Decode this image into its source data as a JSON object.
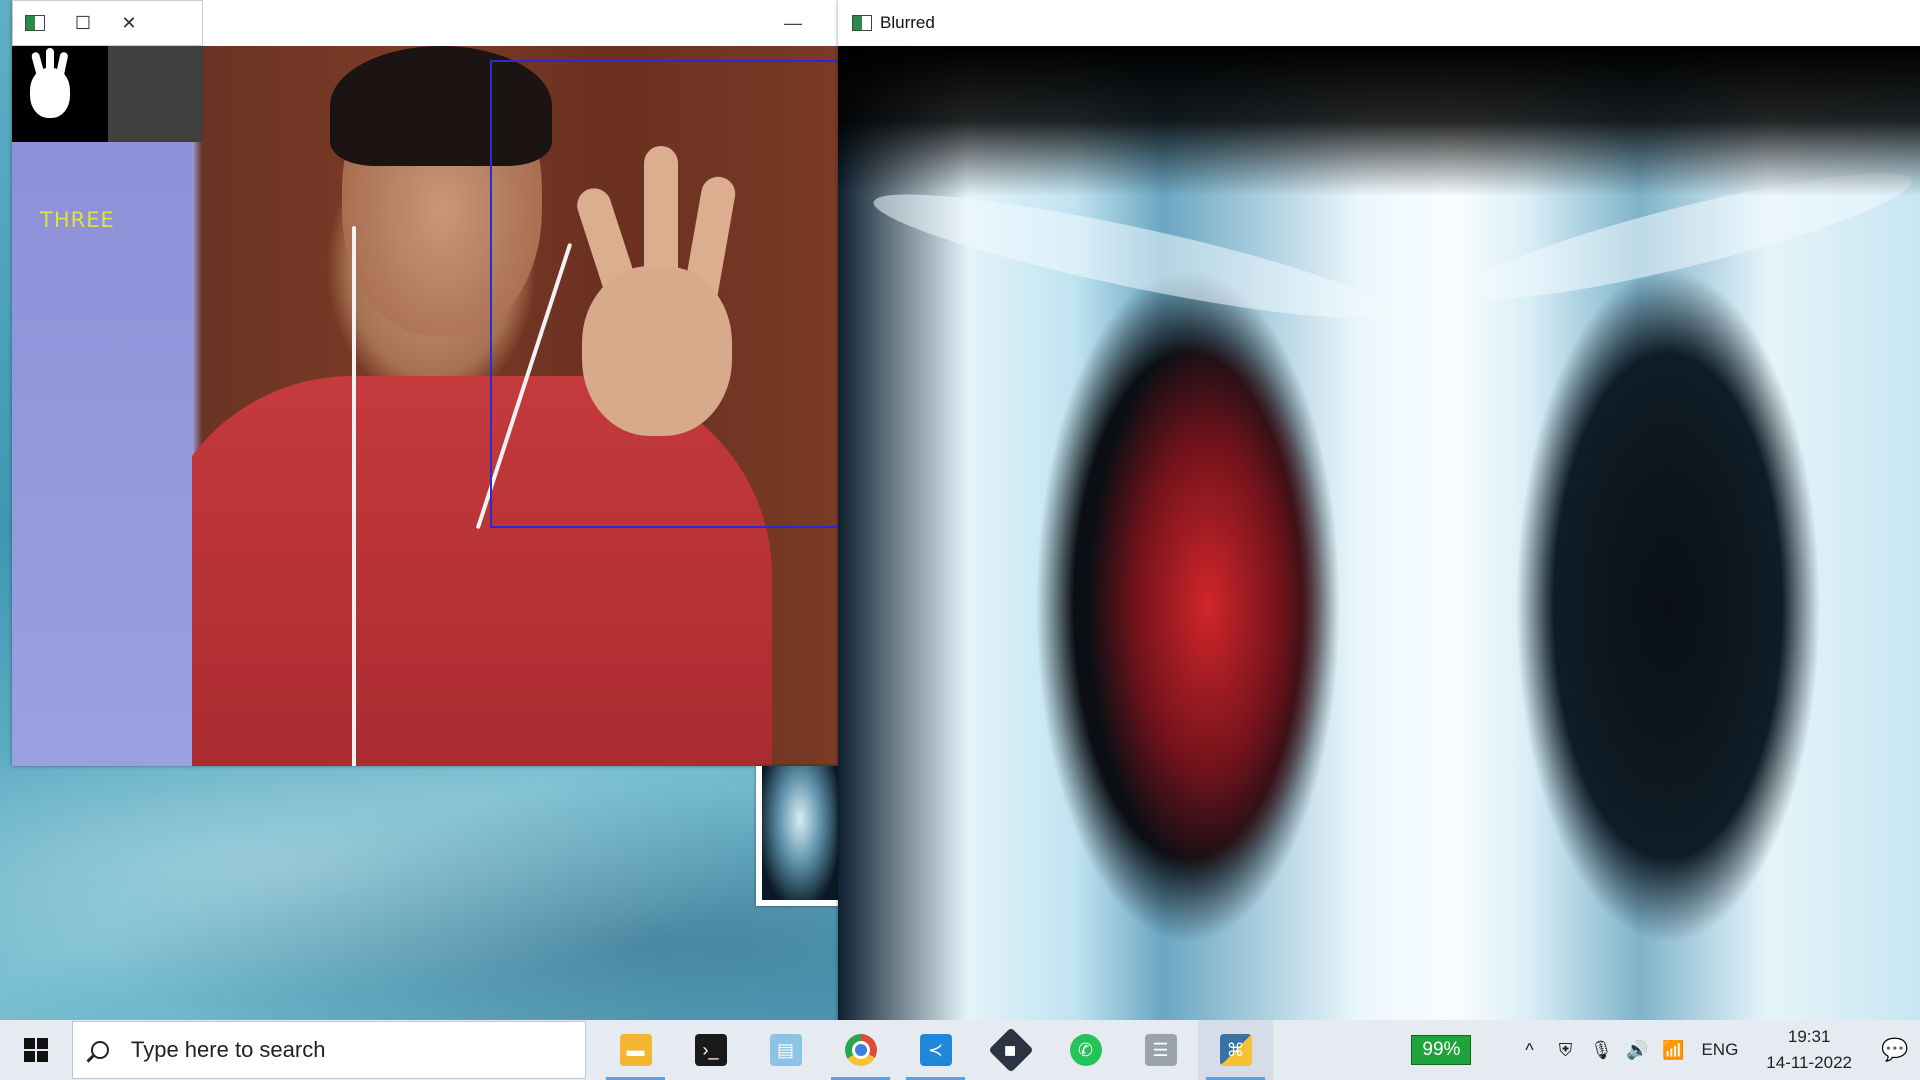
{
  "camera_window": {
    "gesture_label": "THREE",
    "minimize_glyph": "—"
  },
  "mask_window": {
    "maximize_glyph": "☐",
    "close_glyph": "✕"
  },
  "blurred_window": {
    "title": "Blurred"
  },
  "taskbar": {
    "search_placeholder": "Type here to search",
    "apps": [
      {
        "name": "file-explorer-icon",
        "color": "#f2b632"
      },
      {
        "name": "terminal-icon",
        "color": "#1a1a1a"
      },
      {
        "name": "notes-icon",
        "color": "#8cc3e6"
      },
      {
        "name": "chrome-icon",
        "color": "#e04a3a"
      },
      {
        "name": "vscode-icon",
        "color": "#1f88d8"
      },
      {
        "name": "dev-tool-icon",
        "color": "#2b3440"
      },
      {
        "name": "whatsapp-icon",
        "color": "#25c45a"
      },
      {
        "name": "database-icon",
        "color": "#9aa3ab"
      },
      {
        "name": "python-icon",
        "color": "#3772a4"
      }
    ],
    "battery": "99%",
    "tray_chevron": "^",
    "language": "ENG",
    "time": "19:31",
    "date": "14-11-2022"
  }
}
